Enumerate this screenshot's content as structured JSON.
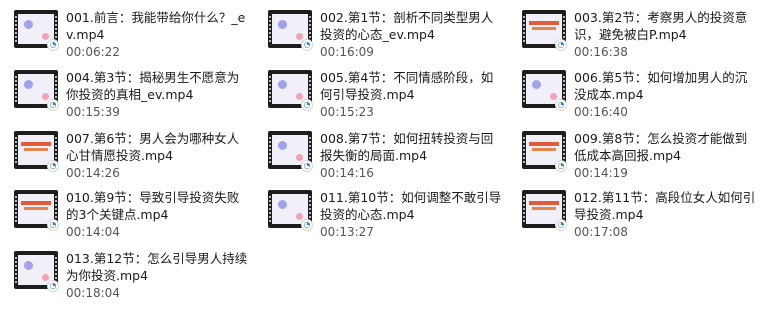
{
  "files": [
    {
      "name": "001.前言：我能带给你什么？_ev.mp4",
      "duration": "00:06:22",
      "thumb": "plain"
    },
    {
      "name": "002.第1节：剖析不同类型男人投资的心态_ev.mp4",
      "duration": "00:16:09",
      "thumb": "plain"
    },
    {
      "name": "003.第2节：考察男人的投资意识，避免被白P.mp4",
      "duration": "00:16:38",
      "thumb": "titled"
    },
    {
      "name": "004.第3节：揭秘男生不愿意为你投资的真相_ev.mp4",
      "duration": "00:15:39",
      "thumb": "plain"
    },
    {
      "name": "005.第4节：不同情感阶段，如何引导投资.mp4",
      "duration": "00:15:23",
      "thumb": "plain"
    },
    {
      "name": "006.第5节：如何增加男人的沉没成本.mp4",
      "duration": "00:16:40",
      "thumb": "plain"
    },
    {
      "name": "007.第6节：男人会为哪种女人心甘情愿投资.mp4",
      "duration": "00:14:26",
      "thumb": "titled"
    },
    {
      "name": "008.第7节：如何扭转投资与回报失衡的局面.mp4",
      "duration": "00:14:16",
      "thumb": "plain"
    },
    {
      "name": "009.第8节：怎么投资才能做到低成本高回报.mp4",
      "duration": "00:14:19",
      "thumb": "titled"
    },
    {
      "name": "010.第9节：导致引导投资失败的3个关键点.mp4",
      "duration": "00:14:04",
      "thumb": "titled"
    },
    {
      "name": "011.第10节：如何调整不敢引导投资的心态.mp4",
      "duration": "00:13:27",
      "thumb": "plain"
    },
    {
      "name": "012.第11节：高段位女人如何引导投资.mp4",
      "duration": "00:17:08",
      "thumb": "titled"
    },
    {
      "name": "013.第12节：怎么引导男人持续为你投资.mp4",
      "duration": "00:18:04",
      "thumb": "plain"
    }
  ],
  "icons": {
    "thumbnail": "video-thumbnail-icon",
    "badge": "player-badge-icon"
  }
}
